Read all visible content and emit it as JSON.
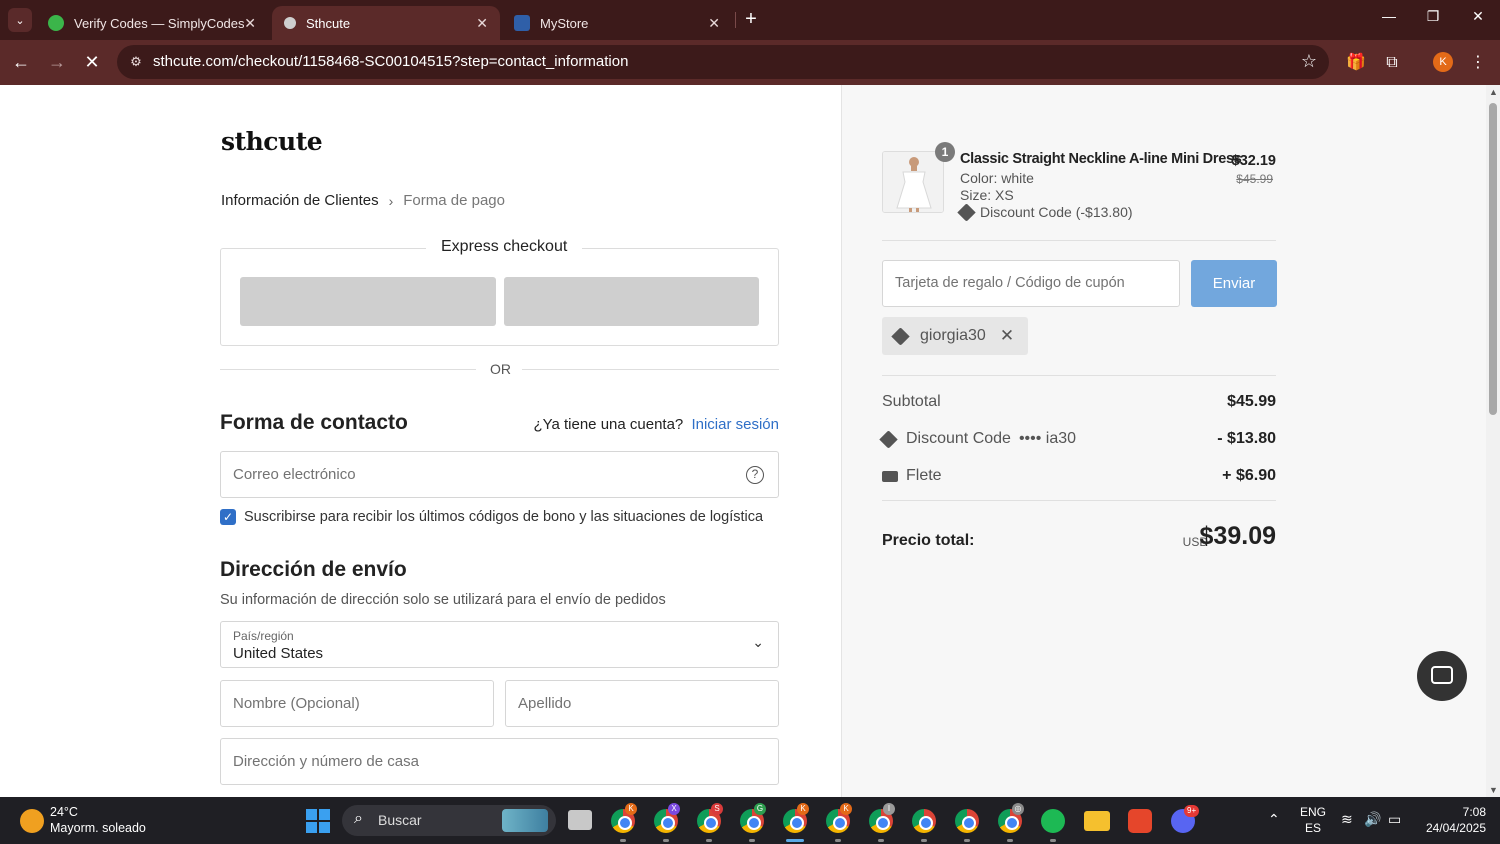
{
  "browser": {
    "tabs": [
      {
        "title": "Verify Codes — SimplyCodes",
        "favicon": "simplycodes-icon",
        "active": false
      },
      {
        "title": "Sthcute",
        "favicon": "sthcute-icon",
        "active": true
      },
      {
        "title": "MyStore",
        "favicon": "mystore-icon",
        "active": false
      }
    ],
    "url": "sthcute.com/checkout/1158468-SC00104515?step=contact_information",
    "profile_initial": "K",
    "theme_color": "#5b2a29"
  },
  "checkout": {
    "logo": "sthcute",
    "breadcrumb": {
      "step1": "Información de Clientes",
      "step2": "Forma de pago"
    },
    "express_title": "Express checkout",
    "or_label": "OR",
    "contact": {
      "heading": "Forma de contacto",
      "account_question": "¿Ya tiene una cuenta?",
      "login_link": "Iniciar sesión",
      "email_placeholder": "Correo electrónico",
      "subscribe_label": "Suscribirse para recibir los últimos códigos de bono y las situaciones de logística",
      "subscribe_checked": true
    },
    "shipping": {
      "heading": "Dirección de envío",
      "subtitle": "Su información de dirección solo se utilizará para el envío de pedidos",
      "country_label": "País/región",
      "country_value": "United States",
      "first_name_placeholder": "Nombre (Opcional)",
      "last_name_placeholder": "Apellido",
      "address_placeholder": "Dirección y número de casa"
    }
  },
  "summary": {
    "item": {
      "quantity": "1",
      "name": "Classic Straight Neckline A-line Mini Dress",
      "color": "Color: white",
      "size": "Size: XS",
      "discount": "Discount Code (-$13.80)",
      "price": "$32.19",
      "original_price": "$45.99"
    },
    "coupon_placeholder": "Tarjeta de regalo / Código de cupón",
    "submit_label": "Enviar",
    "applied_code": "giorgia30",
    "subtotal_label": "Subtotal",
    "subtotal_value": "$45.99",
    "discount_label": "Discount Code",
    "discount_code_masked": "•••• ia30",
    "discount_value": "- $13.80",
    "shipping_label": "Flete",
    "shipping_value": "+ $6.90",
    "total_label": "Precio total:",
    "currency": "USD",
    "total_value": "$39.09",
    "accent_color": "#72a7dd"
  },
  "taskbar": {
    "weather_temp": "24°C",
    "weather_desc": "Mayorm. soleado",
    "search_label": "Buscar",
    "lang_primary": "ENG",
    "lang_secondary": "ES",
    "time": "7:08",
    "date": "24/04/2025",
    "chrome_badges": [
      "K",
      "X",
      "S",
      "G",
      "K",
      "K",
      "I",
      "",
      "",
      "◎"
    ],
    "discord_badge": "9+"
  }
}
